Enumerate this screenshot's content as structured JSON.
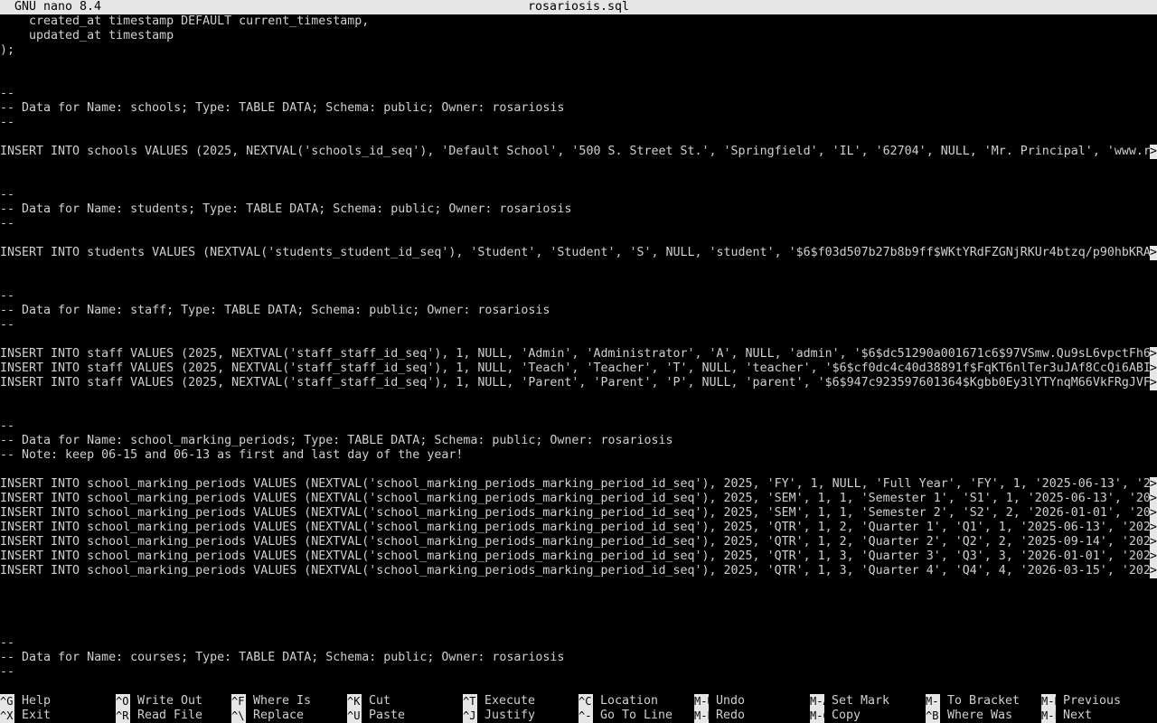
{
  "titlebar": {
    "app": "GNU nano 8.4",
    "filename": "rosariosis.sql"
  },
  "lines": [
    {
      "text": "    created_at timestamp DEFAULT current_timestamp,"
    },
    {
      "text": "    updated_at timestamp"
    },
    {
      "text": ");"
    },
    {
      "text": ""
    },
    {
      "text": ""
    },
    {
      "text": "--"
    },
    {
      "text": "-- Data for Name: schools; Type: TABLE DATA; Schema: public; Owner: rosariosis"
    },
    {
      "text": "--"
    },
    {
      "text": ""
    },
    {
      "text": "INSERT INTO schools VALUES (2025, NEXTVAL('schools_id_seq'), 'Default School', '500 S. Street St.', 'Springfield', 'IL', '62704', NULL, 'Mr. Principal', 'www.r",
      "more": ">"
    },
    {
      "text": ""
    },
    {
      "text": ""
    },
    {
      "text": "--"
    },
    {
      "text": "-- Data for Name: students; Type: TABLE DATA; Schema: public; Owner: rosariosis"
    },
    {
      "text": "--"
    },
    {
      "text": ""
    },
    {
      "text": "INSERT INTO students VALUES (NEXTVAL('students_student_id_seq'), 'Student', 'Student', 'S', NULL, 'student', '$6$f03d507b27b8b9ff$WKtYRdFZGNjRKUr4btzq/p90hbKRA",
      "more": ">"
    },
    {
      "text": ""
    },
    {
      "text": ""
    },
    {
      "text": "--"
    },
    {
      "text": "-- Data for Name: staff; Type: TABLE DATA; Schema: public; Owner: rosariosis"
    },
    {
      "text": "--"
    },
    {
      "text": ""
    },
    {
      "text": "INSERT INTO staff VALUES (2025, NEXTVAL('staff_staff_id_seq'), 1, NULL, 'Admin', 'Administrator', 'A', NULL, 'admin', '$6$dc51290a001671c6$97VSmw.Qu9sL6vpctFh6",
      "more": ">"
    },
    {
      "text": "INSERT INTO staff VALUES (2025, NEXTVAL('staff_staff_id_seq'), 1, NULL, 'Teach', 'Teacher', 'T', NULL, 'teacher', '$6$cf0dc4c40d38891f$FqKT6nlTer3uJAf8CcQi6ABI",
      "more": ">"
    },
    {
      "text": "INSERT INTO staff VALUES (2025, NEXTVAL('staff_staff_id_seq'), 1, NULL, 'Parent', 'Parent', 'P', NULL, 'parent', '$6$947c9235976013​64$Kgbb0Ey3lYTYnqM66VkFRgJVF",
      "more": ">"
    },
    {
      "text": ""
    },
    {
      "text": ""
    },
    {
      "text": "--"
    },
    {
      "text": "-- Data for Name: school_marking_periods; Type: TABLE DATA; Schema: public; Owner: rosariosis"
    },
    {
      "text": "-- Note: keep 06-15 and 06-13 as first and last day of the year!"
    },
    {
      "text": ""
    },
    {
      "text": "INSERT INTO school_marking_periods VALUES (NEXTVAL('school_marking_periods_marking_period_id_seq'), 2025, 'FY', 1, NULL, 'Full Year', 'FY', 1, '2025-06-13', '2",
      "more": ">"
    },
    {
      "text": "INSERT INTO school_marking_periods VALUES (NEXTVAL('school_marking_periods_marking_period_id_seq'), 2025, 'SEM', 1, 1, 'Semester 1', 'S1', 1, '2025-06-13', '20",
      "more": ">"
    },
    {
      "text": "INSERT INTO school_marking_periods VALUES (NEXTVAL('school_marking_periods_marking_period_id_seq'), 2025, 'SEM', 1, 1, 'Semester 2', 'S2', 2, '2026-01-01', '20",
      "more": ">"
    },
    {
      "text": "INSERT INTO school_marking_periods VALUES (NEXTVAL('school_marking_periods_marking_period_id_seq'), 2025, 'QTR', 1, 2, 'Quarter 1', 'Q1', 1, '2025-06-13', '202",
      "more": ">"
    },
    {
      "text": "INSERT INTO school_marking_periods VALUES (NEXTVAL('school_marking_periods_marking_period_id_seq'), 2025, 'QTR', 1, 2, 'Quarter 2', 'Q2', 2, '2025-09-14', '202",
      "more": ">"
    },
    {
      "text": "INSERT INTO school_marking_periods VALUES (NEXTVAL('school_marking_periods_marking_period_id_seq'), 2025, 'QTR', 1, 3, 'Quarter 3', 'Q3', 3, '2026-01-01', '202",
      "more": ">"
    },
    {
      "text": "INSERT INTO school_marking_periods VALUES (NEXTVAL('school_marking_periods_marking_period_id_seq'), 2025, 'QTR', 1, 3, 'Quarter 4', 'Q4', 4, '2026-03-15', '202",
      "more": ">"
    },
    {
      "text": ""
    },
    {
      "text": ""
    },
    {
      "text": ""
    },
    {
      "text": ""
    },
    {
      "text": "--"
    },
    {
      "text": "-- Data for Name: courses; Type: TABLE DATA; Schema: public; Owner: rosariosis"
    },
    {
      "text": "--"
    }
  ],
  "shortcuts": [
    {
      "key1": "^G",
      "label1": "Help",
      "key2": "^X",
      "label2": "Exit"
    },
    {
      "key1": "^O",
      "label1": "Write Out",
      "key2": "^R",
      "label2": "Read File"
    },
    {
      "key1": "^F",
      "label1": "Where Is",
      "key2": "^\\",
      "label2": "Replace"
    },
    {
      "key1": "^K",
      "label1": "Cut",
      "key2": "^U",
      "label2": "Paste"
    },
    {
      "key1": "^T",
      "label1": "Execute",
      "key2": "^J",
      "label2": "Justify"
    },
    {
      "key1": "^C",
      "label1": "Location",
      "key2": "^-",
      "label2": "Go To Line"
    },
    {
      "key1": "M-U",
      "label1": "Undo",
      "key2": "M-E",
      "label2": "Redo"
    },
    {
      "key1": "M-A",
      "label1": "Set Mark",
      "key2": "M-6",
      "label2": "Copy"
    },
    {
      "key1": "M-]",
      "label1": "To Bracket",
      "key2": "^B",
      "label2": "Where Was"
    },
    {
      "key1": "M-B",
      "label1": "Previous",
      "key2": "M-F",
      "label2": "Next"
    }
  ],
  "colors": {
    "background": "#000000",
    "text": "#d0d0d0",
    "bar": "#e6e6e6"
  }
}
